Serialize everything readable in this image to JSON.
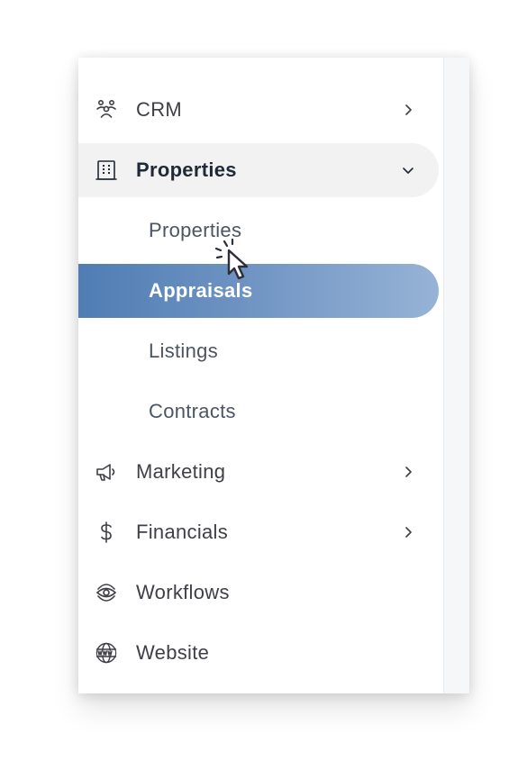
{
  "nav": {
    "crm": {
      "label": "CRM",
      "icon": "people-group-icon",
      "chevron": "chevron-right-icon"
    },
    "properties": {
      "label": "Properties",
      "icon": "building-icon",
      "chevron": "chevron-down-icon"
    },
    "properties_sub": {
      "properties": "Properties",
      "appraisals": "Appraisals",
      "listings": "Listings",
      "contracts": "Contracts"
    },
    "marketing": {
      "label": "Marketing",
      "icon": "megaphone-icon",
      "chevron": "chevron-right-icon"
    },
    "financials": {
      "label": "Financials",
      "icon": "dollar-icon",
      "chevron": "chevron-right-icon"
    },
    "workflows": {
      "label": "Workflows",
      "icon": "eye-cycle-icon"
    },
    "website": {
      "label": "Website",
      "icon": "www-globe-icon"
    }
  },
  "colors": {
    "text": "#3f3f46",
    "active_start": "#4f7db4",
    "active_end": "#97b3d6",
    "parent_bg": "#f2f2f3"
  }
}
